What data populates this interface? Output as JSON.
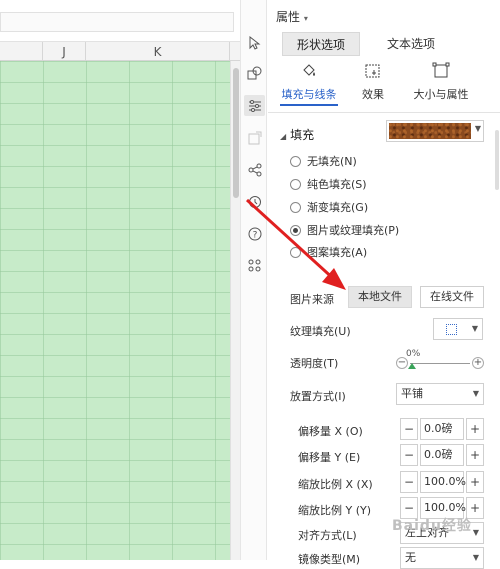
{
  "sheet": {
    "columns": [
      "J",
      "K"
    ]
  },
  "panel": {
    "title": "属性",
    "title_caret": "▾",
    "tabs": [
      {
        "label": "形状选项",
        "active": true
      },
      {
        "label": "文本选项",
        "active": false
      }
    ],
    "subtabs": [
      {
        "label": "填充与线条",
        "icon": "paint-bucket-icon",
        "active": true
      },
      {
        "label": "效果",
        "icon": "effects-icon",
        "active": false
      },
      {
        "label": "大小与属性",
        "icon": "size-icon",
        "active": false
      }
    ],
    "fill": {
      "section_label": "填充",
      "options": [
        {
          "label": "无填充(N)",
          "checked": false
        },
        {
          "label": "纯色填充(S)",
          "checked": false
        },
        {
          "label": "渐变填充(G)",
          "checked": false
        },
        {
          "label": "图片或纹理填充(P)",
          "checked": true
        },
        {
          "label": "图案填充(A)",
          "checked": false
        }
      ],
      "image_source_label": "图片来源",
      "local_file_button": "本地文件",
      "online_file_button": "在线文件",
      "texture_label": "纹理填充(U)",
      "transparency_label": "透明度(T)",
      "transparency_value": "0%",
      "placement_label": "放置方式(I)",
      "placement_value": "平铺",
      "offset_x_label": "偏移量 X (O)",
      "offset_x_value": "0.0磅",
      "offset_y_label": "偏移量 Y (E)",
      "offset_y_value": "0.0磅",
      "scale_x_label": "缩放比例 X (X)",
      "scale_x_value": "100.0%",
      "scale_y_label": "缩放比例 Y (Y)",
      "scale_y_value": "100.0%",
      "align_label": "对齐方式(L)",
      "align_value": "左上对齐",
      "mirror_label": "镜像类型(M)",
      "mirror_value": "无"
    }
  },
  "watermark": "Baidu经验",
  "colors": {
    "accent": "#2a62c9",
    "grid": "#c7ebc9",
    "arrow": "#e02020"
  }
}
